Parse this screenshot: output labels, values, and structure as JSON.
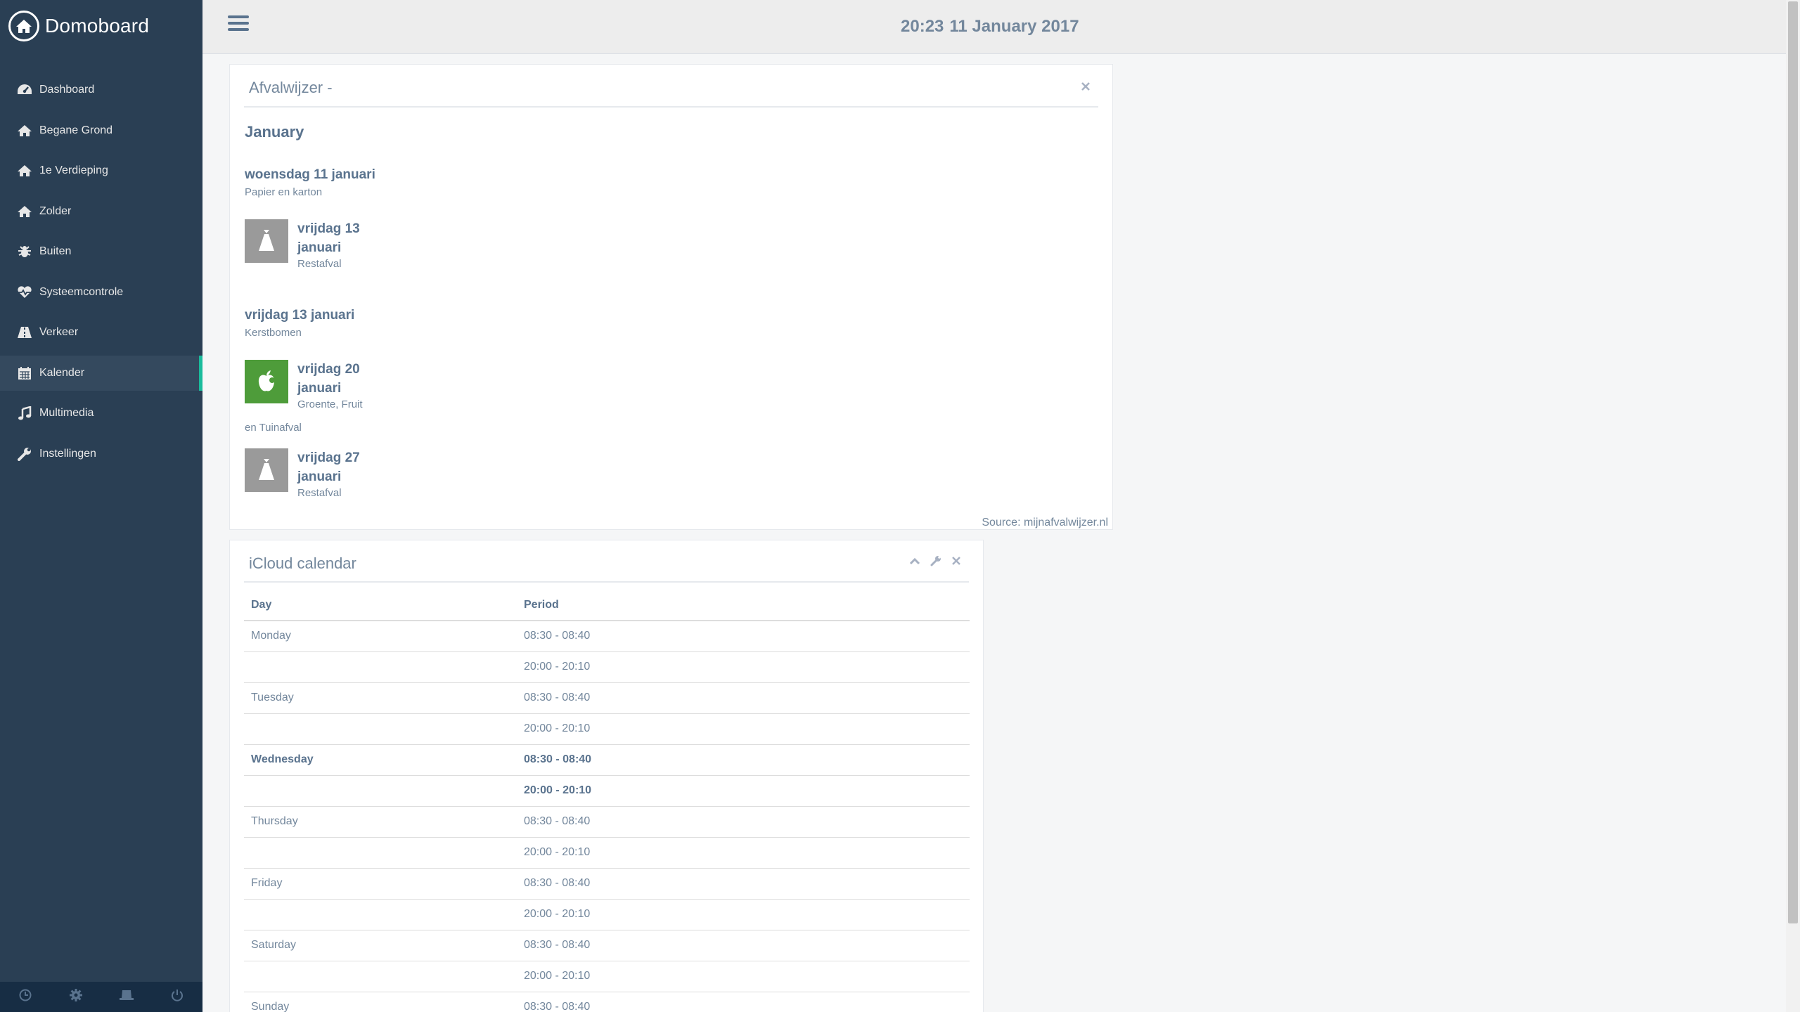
{
  "app": {
    "title": "Domoboard"
  },
  "header": {
    "time": "20:23",
    "date": "11 January 2017"
  },
  "sidebar": {
    "items": [
      {
        "label": "Dashboard",
        "icon": "dashboard-icon"
      },
      {
        "label": "Begane Grond",
        "icon": "home-icon"
      },
      {
        "label": "1e Verdieping",
        "icon": "home-icon"
      },
      {
        "label": "Zolder",
        "icon": "home-icon"
      },
      {
        "label": "Buiten",
        "icon": "bug-icon"
      },
      {
        "label": "Systeemcontrole",
        "icon": "heartbeat-icon"
      },
      {
        "label": "Verkeer",
        "icon": "road-icon"
      },
      {
        "label": "Kalender",
        "icon": "calendar-icon",
        "active": true
      },
      {
        "label": "Multimedia",
        "icon": "music-icon"
      },
      {
        "label": "Instellingen",
        "icon": "wrench-icon"
      }
    ],
    "footer_icons": [
      "clock-icon",
      "gear-icon",
      "hat-icon",
      "power-icon"
    ]
  },
  "afval": {
    "title": "Afvalwijzer -",
    "month": "January",
    "groups": [
      {
        "heading": "woensdag 11 januari",
        "sub": "Papier en karton"
      },
      {
        "heading": "vrijdag 13 januari",
        "sub": "Kerstbomen"
      }
    ],
    "items": [
      {
        "date_line1": "vrijdag 13",
        "date_line2": "januari",
        "type": "Restafval",
        "icon": "trash-bag-icon",
        "color": "#9a9a9a"
      },
      {
        "date_line1": "vrijdag 20",
        "date_line2": "januari",
        "type": "Groente, Fruit",
        "type_line2": "en Tuinafval",
        "icon": "apple-icon",
        "color": "#4e9c3a"
      },
      {
        "date_line1": "vrijdag 27",
        "date_line2": "januari",
        "type": "Restafval",
        "icon": "trash-bag-icon",
        "color": "#9a9a9a"
      }
    ],
    "source": "Source: mijnafvalwijzer.nl"
  },
  "icloud": {
    "title": "iCloud calendar",
    "columns": [
      "Day",
      "Period"
    ],
    "rows": [
      {
        "day": "Monday",
        "period": "08:30 - 08:40"
      },
      {
        "day": "",
        "period": "20:00 - 20:10"
      },
      {
        "day": "Tuesday",
        "period": "08:30 - 08:40"
      },
      {
        "day": "",
        "period": "20:00 - 20:10"
      },
      {
        "day": "Wednesday",
        "period": "08:30 - 08:40",
        "today": true
      },
      {
        "day": "",
        "period": "20:00 - 20:10",
        "today": true
      },
      {
        "day": "Thursday",
        "period": "08:30 - 08:40"
      },
      {
        "day": "",
        "period": "20:00 - 20:10"
      },
      {
        "day": "Friday",
        "period": "08:30 - 08:40"
      },
      {
        "day": "",
        "period": "20:00 - 20:10"
      },
      {
        "day": "Saturday",
        "period": "08:30 - 08:40"
      },
      {
        "day": "",
        "period": "20:00 - 20:10"
      },
      {
        "day": "Sunday",
        "period": "08:30 - 08:40"
      }
    ]
  },
  "colors": {
    "sidebar": "#2a3f54",
    "accent": "#1abb9c",
    "text": "#73879c",
    "green": "#4e9c3a"
  }
}
